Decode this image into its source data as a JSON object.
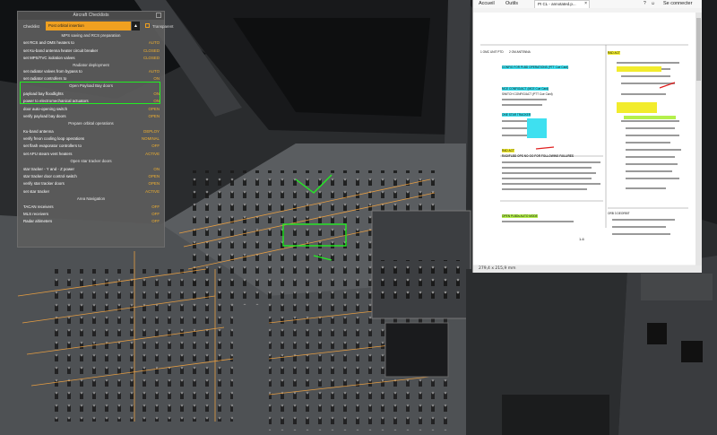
{
  "checklist_window": {
    "title": "Aircraft Checklists",
    "checklist_label": "Checklist",
    "checklist_selected": "Post orbital insertion",
    "transparent_label": "Transparent",
    "sections": [
      {
        "header": "MPS saving and RCS preparation",
        "items": [
          {
            "label": "set RCS and OMS heaters to",
            "value": "AUTO"
          },
          {
            "label": "set Ku-band antenna heater circuit breaker",
            "value": "CLOSED"
          },
          {
            "label": "set MPS/TVC isolation valves",
            "value": "CLOSED"
          }
        ]
      },
      {
        "header": "Radiator deployment",
        "items": [
          {
            "label": "set radiator valves from bypass to",
            "value": "AUTO"
          },
          {
            "label": "set radiator controllers to",
            "value": "ON"
          }
        ]
      },
      {
        "header": "Open Payload Bay doors",
        "items": [
          {
            "label": "payload bay floodlights",
            "value": "ON"
          },
          {
            "label": "power to electromechanical actuators",
            "value": "ON"
          },
          {
            "label": "door auto-opening switch",
            "value": "OPEN"
          },
          {
            "label": "verify payload bay doors",
            "value": "OPEN"
          }
        ]
      },
      {
        "header": "Prepare orbital operations",
        "items": [
          {
            "label": "Ku-band antenna",
            "value": "DEPLOY"
          },
          {
            "label": "verify freon cooling loop operations",
            "value": "NOMINAL"
          },
          {
            "label": "set flash evaporator controllers to",
            "value": "OFF"
          },
          {
            "label": "set APU steam vent heaters",
            "value": "ACTIVE"
          }
        ]
      },
      {
        "header": "Open star tracker doors",
        "items": [
          {
            "label": "star tracker - Y and - Z power",
            "value": "ON"
          },
          {
            "label": "star tracker door control switch",
            "value": "OPEN"
          },
          {
            "label": "verify star tracker doors",
            "value": "OPEN"
          },
          {
            "label": "set star tracker",
            "value": "ACTIVE"
          }
        ]
      },
      {
        "header": "Area Navigation",
        "items": [
          {
            "label": "TACAN receivers",
            "value": "OFF"
          },
          {
            "label": "MLS receivers",
            "value": "OFF"
          },
          {
            "label": "Radar altimeters",
            "value": "OFF"
          }
        ]
      }
    ]
  },
  "document_viewer": {
    "menu": [
      "Accueil",
      "Outils"
    ],
    "tab_title": "PI CL - annotated.p...",
    "sign_in": "Se connecter",
    "page_label": "1-6",
    "page_size": "279,4 x 215,9 mm",
    "procedure_lines": [
      "1   OMC UNIT PTD",
      "2   OM ANTENNA",
      "CONFIG FOR PLBD OPERATIONS (PTT Cue Card)",
      "RAD ACT",
      "MCE CONFIG/ACT (MCE Cue Card)",
      "SWITCH CONFIG/ACT (PTT Cue Card)",
      "ONE STAR TRACKER",
      "RAD ACT",
      "RAD/FLBD OPS NO GO FOR FOLLOWING FAILURES",
      "ORB 3 DEORBIT",
      "OPEN PLBDs AUTO MODE"
    ]
  },
  "colors": {
    "checklist_value": "#f0b030",
    "selection": "#f0a020",
    "highlight_box": "#22ee22",
    "panel_light": "#f5a540"
  }
}
